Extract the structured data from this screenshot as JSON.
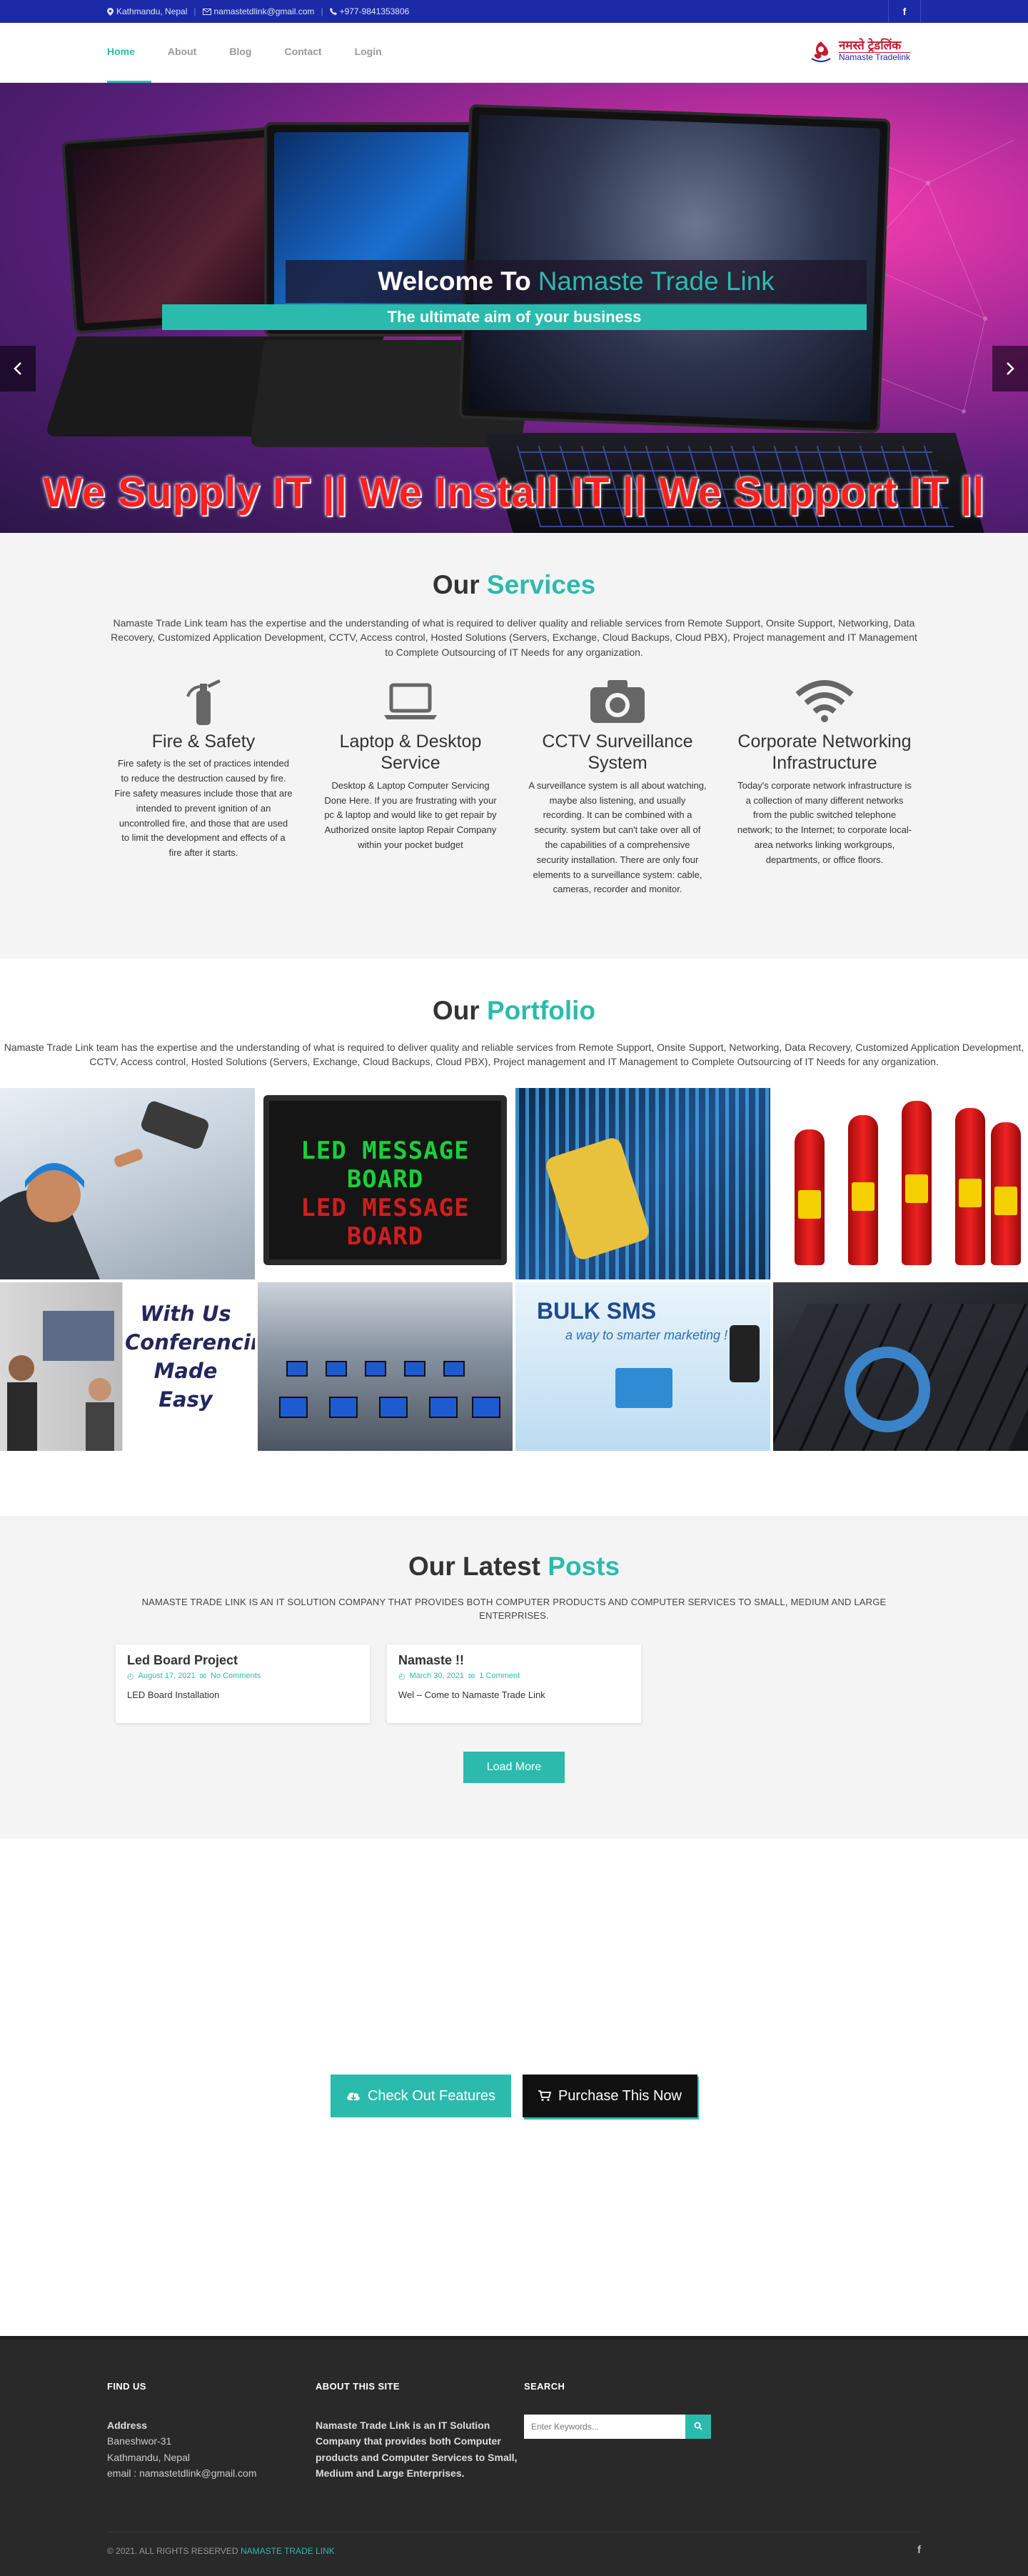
{
  "topbar": {
    "location": "Kathmandu, Nepal",
    "email": "namastetdlink@gmail.com",
    "phone": "+977-9841353806",
    "social_fb": "f"
  },
  "nav": {
    "items": [
      {
        "label": "Home",
        "active": true
      },
      {
        "label": "About"
      },
      {
        "label": "Blog"
      },
      {
        "label": "Contact"
      },
      {
        "label": "Login"
      }
    ],
    "logo_primary": "नमस्ते ट्रेडलिंक",
    "logo_secondary": "Namaste Tradelink"
  },
  "hero": {
    "title_prefix": "Welcome To",
    "title_accent": "Namaste Trade Link",
    "subtitle": "The ultimate aim of your business",
    "slogan": "We Supply IT || We Install IT || We Support IT ||",
    "prev_icon": "chevron-left-icon",
    "next_icon": "chevron-right-icon"
  },
  "services": {
    "title_prefix": "Our",
    "title_accent": "Services",
    "description": "Namaste Trade Link team has the expertise and the understanding of what is required to deliver quality and reliable services from Remote Support, Onsite Support, Networking, Data Recovery, Customized Application Development, CCTV, Access control, Hosted Solutions (Servers, Exchange, Cloud Backups, Cloud PBX), Project management and IT Management to Complete Outsourcing of IT Needs for any organization.",
    "items": [
      {
        "name": "Fire & Safety",
        "icon": "fire-extinguisher-icon",
        "text": "Fire safety is the set of practices intended to reduce the destruction caused by fire. Fire safety measures include those that are intended to prevent ignition of an uncontrolled fire, and those that are used to limit the development and effects of a fire after it starts."
      },
      {
        "name": "Laptop & Desktop Service",
        "icon": "laptop-icon",
        "text": "Desktop & Laptop Computer Servicing Done Here. If you are frustrating with your pc & laptop and would like to get repair by Authorized onsite laptop Repair Company within your pocket budget"
      },
      {
        "name": "CCTV Surveillance System",
        "icon": "camera-icon",
        "text": "A surveillance system is all about watching, maybe also listening, and usually recording. It can be combined with a security. system but can't take over all of the capabilities of a comprehensive security installation. There are only four elements to a surveillance system: cable, cameras, recorder and monitor."
      },
      {
        "name": "Corporate Networking Infrastructure",
        "icon": "wifi-icon",
        "text": "Today's corporate network infrastructure is a collection of many different networks from the public switched telephone network; to the Internet; to corporate local-area networks linking workgroups, departments, or office floors."
      }
    ]
  },
  "portfolio": {
    "title_prefix": "Our",
    "title_accent": "Portfolio",
    "description": "Namaste Trade Link team has the expertise and the understanding of what is required to deliver quality and reliable services from Remote Support, Onsite Support, Networking, Data Recovery, Customized Application Development, CCTV, Access control, Hosted Solutions (Servers, Exchange, Cloud Backups, Cloud PBX), Project management and IT Management to Complete Outsourcing of IT Needs for any organization.",
    "led_line1": "LED MESSAGE BOARD",
    "led_line2": "LED MESSAGE BOARD",
    "conf_text": "With Us Conferencing Made Easy",
    "sms_title": "BULK SMS",
    "sms_sub": "a way to smarter marketing !"
  },
  "posts": {
    "title_prefix": "Our Latest",
    "title_accent": "Posts",
    "description": "NAMASTE TRADE LINK IS AN IT SOLUTION COMPANY THAT PROVIDES BOTH COMPUTER PRODUCTS AND COMPUTER SERVICES TO SMALL, MEDIUM AND LARGE ENTERPRISES.",
    "items": [
      {
        "title": "Led Board Project",
        "date": "August 17, 2021",
        "comments": "No Comments",
        "excerpt": "LED Board Installation"
      },
      {
        "title": "Namaste !!",
        "date": "March 30, 2021",
        "comments": "1 Comment",
        "excerpt": "Wel – Come to Namaste Trade Link"
      }
    ],
    "load_more": "Load More"
  },
  "cta": {
    "features": "Check Out Features",
    "purchase": "Purchase This Now"
  },
  "footer": {
    "find_us": "FIND US",
    "address_label": "Address",
    "address_line1": "Baneshwor-31",
    "address_line2": "Kathmandu, Nepal",
    "email_line": "email : namastetdlink@gmail.com",
    "about_title": "ABOUT THIS SITE",
    "about_text": "Namaste Trade Link is an IT Solution Company that provides both Computer products and Computer Services to Small, Medium and Large Enterprises.",
    "search_title": "SEARCH",
    "search_placeholder": "Enter Keywords...",
    "copyright": "© 2021. ALL RIGHTS RESERVED",
    "brand": "NAMASTE TRADE LINK",
    "social_fb": "f"
  },
  "colors": {
    "accent": "#2bbbad",
    "topbar": "#1c2aa8",
    "footer": "#292929"
  }
}
